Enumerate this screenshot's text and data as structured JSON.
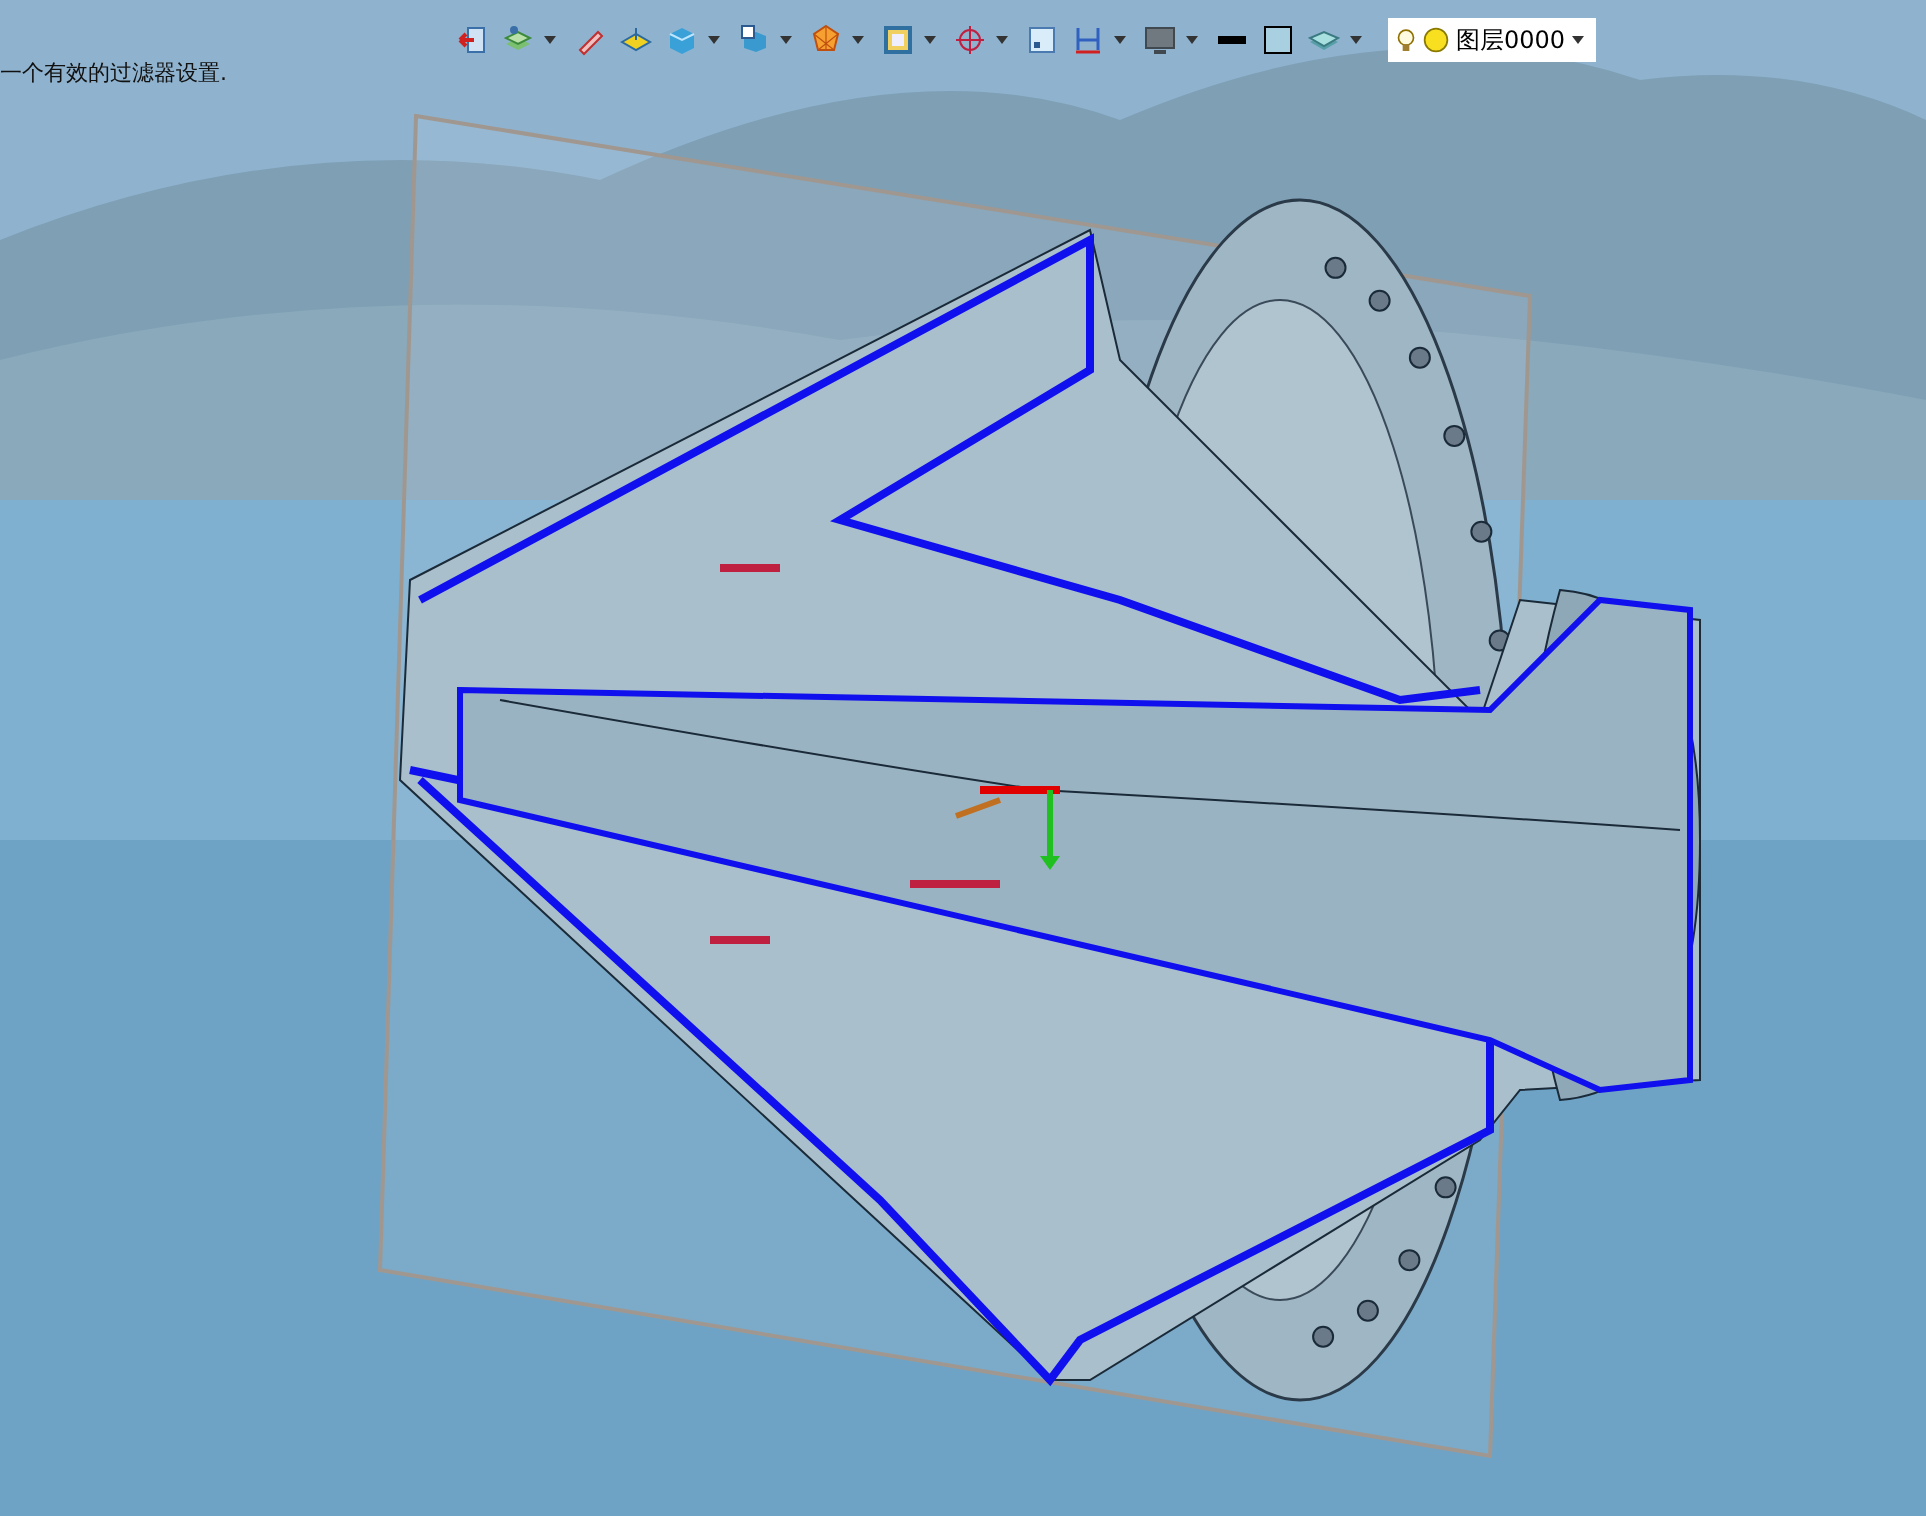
{
  "message": "一个有效的过滤器设置.",
  "toolbar": {
    "tools": [
      {
        "kind": "exit",
        "dropdown": false
      },
      {
        "kind": "layers",
        "dropdown": true
      },
      {
        "kind": "pencil",
        "dropdown": false
      },
      {
        "kind": "plane",
        "dropdown": false
      },
      {
        "kind": "cube",
        "dropdown": true
      },
      {
        "kind": "box",
        "dropdown": true
      },
      {
        "kind": "polygon",
        "dropdown": true
      },
      {
        "kind": "frame",
        "dropdown": true
      },
      {
        "kind": "target",
        "dropdown": true
      },
      {
        "kind": "view",
        "dropdown": false
      },
      {
        "kind": "dimension",
        "dropdown": true
      },
      {
        "kind": "monitor",
        "dropdown": true
      },
      {
        "kind": "line",
        "dropdown": false
      },
      {
        "kind": "fill",
        "dropdown": false
      },
      {
        "kind": "stack",
        "dropdown": true
      }
    ],
    "layer": {
      "text": "图层0000"
    }
  }
}
